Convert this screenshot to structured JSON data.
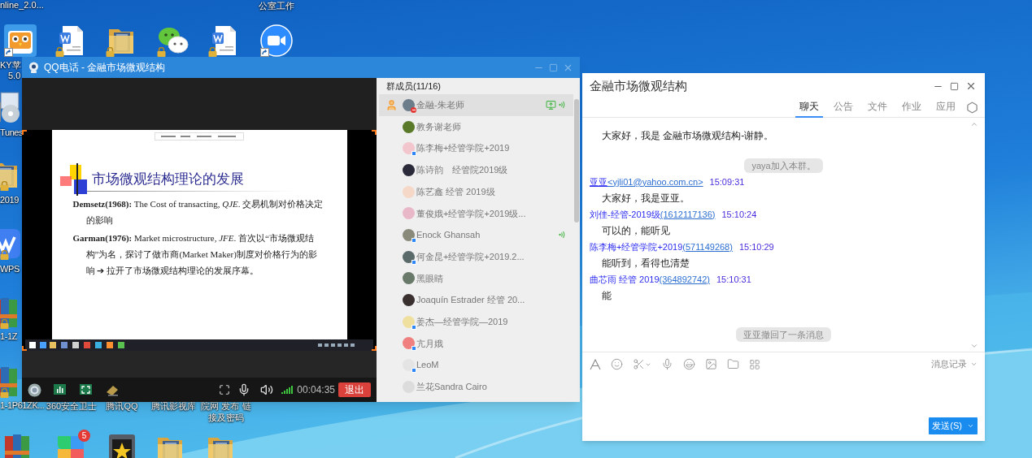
{
  "desktop": {
    "top_labels": [
      "nline_2.0...",
      "公室工作"
    ],
    "top_row": [
      {
        "kind": "owl",
        "label": [
          "KY苹",
          "5.0"
        ],
        "shortcut": true
      },
      {
        "kind": "word",
        "locked": true
      },
      {
        "kind": "folder",
        "locked": true
      },
      {
        "kind": "wechat",
        "locked": true
      },
      {
        "kind": "word",
        "locked": true
      },
      {
        "kind": "zoom",
        "shortcut": true
      }
    ],
    "left_column": [
      {
        "kind": "itunes",
        "label": "Tunes"
      },
      {
        "kind": "folder",
        "label": "2019",
        "locked": true
      },
      {
        "kind": "wps",
        "label": "WPS",
        "locked": true
      },
      {
        "kind": "archive",
        "label": "1-1Z",
        "locked": true
      },
      {
        "kind": "archive",
        "label": "1-1P61ZK...",
        "locked": true
      }
    ],
    "bottom_labels": [
      [
        "360安全卫士"
      ],
      [
        "腾讯QQ"
      ],
      [
        "腾讯影视库"
      ],
      [
        "院网 发布 链",
        "接及密码"
      ]
    ],
    "bottom_row": [
      {
        "kind": "archive"
      },
      {
        "kind": "apps",
        "badge": "5"
      },
      {
        "kind": "game"
      },
      {
        "kind": "folder"
      },
      {
        "kind": "folder"
      }
    ]
  },
  "call_window": {
    "title": "QQ电话 - 金融市场微观结构",
    "slide": {
      "title": "市场微观结构理论的发展",
      "paragraphs": [
        "**Demsetz(1968):** The Cost of transacting, *QJE*. 交易机制对价格决定的影响",
        "**Garman(1976):** Market microstructure, *JFE*. 首次以“市场微观结构”为名，探讨了做市商(Market Maker)制度对价格行为的影响 ➔ 拉开了市场微观结构理论的发展序幕。"
      ]
    },
    "timer": "00:04:35",
    "exit_button": "退出",
    "members_header": "群成员(11/16)",
    "members": [
      {
        "name": "金融-朱老师",
        "selected": true,
        "host": true,
        "muted": true,
        "sharing": true,
        "speaking": true,
        "color": "#6b7c8a"
      },
      {
        "name": "教务谢老师",
        "selected": false,
        "color": "#5a7a2a"
      },
      {
        "name": "陈李梅+经管学院+2019",
        "selected": false,
        "mobile": true,
        "color": "#f2c6cc"
      },
      {
        "name": "陈诗韵　经管院2019级",
        "selected": false,
        "color": "#2a2a3a"
      },
      {
        "name": "陈艺鑫 经管 2019级",
        "selected": false,
        "color": "#f6d8c8"
      },
      {
        "name": "董俊娥+经管学院+2019级...",
        "selected": false,
        "color": "#e8b8c8"
      },
      {
        "name": "Enock Ghansah",
        "selected": false,
        "mobile": true,
        "speaking": true,
        "color": "#8a8a7a"
      },
      {
        "name": "何金昆+经管学院+2019.2...",
        "selected": false,
        "mobile": true,
        "color": "#5a6a6a"
      },
      {
        "name": "黑眼睛",
        "selected": false,
        "color": "#6a7a6a"
      },
      {
        "name": "Joaquín Estrader 经管 20...",
        "selected": false,
        "color": "#3a3030"
      },
      {
        "name": "姜杰—经管学院—2019",
        "selected": false,
        "mobile": true,
        "color": "#f0e0a0"
      },
      {
        "name": "亢月娥",
        "selected": false,
        "mobile": true,
        "color": "#f08080"
      },
      {
        "name": "LeoM",
        "selected": false,
        "mobile": true,
        "color": "#e4e4e4"
      },
      {
        "name": "兰花Sandra Cairo",
        "selected": false,
        "color": "#dcdcdc"
      }
    ]
  },
  "chat_window": {
    "title": "金融市场微观结构",
    "tabs": [
      {
        "label": "聊天",
        "selected": true
      },
      {
        "label": "公告",
        "selected": false
      },
      {
        "label": "文件",
        "selected": false
      },
      {
        "label": "作业",
        "selected": false
      },
      {
        "label": "应用",
        "selected": false
      }
    ],
    "messages": [
      {
        "kind": "message",
        "body": "大家好，我是 金融市场微观结构-谢静。"
      },
      {
        "kind": "system",
        "text": "yaya加入本群。"
      },
      {
        "kind": "message",
        "sender": "亚亚",
        "sender_link": true,
        "id": "<yjli01@yahoo.com.cn>",
        "time": "15:09:31",
        "body": "大家好，我是亚亚。"
      },
      {
        "kind": "message",
        "sender": "刘佳-经管-2019级",
        "id": "(1612117136)",
        "time": "15:10:24",
        "body": "可以的，能听见"
      },
      {
        "kind": "message",
        "sender": "陈李梅+经管学院+2019",
        "id": "(571149268)",
        "time": "15:10:29",
        "body": "能听到，看得也清楚"
      },
      {
        "kind": "message",
        "sender": "曲芯雨 经管 2019",
        "id": "(364892742)",
        "time": "15:10:31",
        "body": "能"
      },
      {
        "kind": "system",
        "text": "亚亚撤回了一条消息"
      }
    ],
    "history_label": "消息记录",
    "send_button": "发送(S)"
  }
}
